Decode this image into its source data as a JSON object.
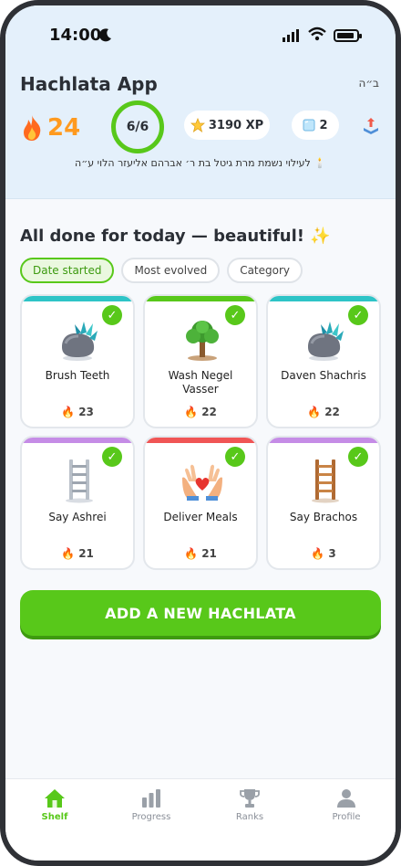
{
  "status": {
    "time": "14:00"
  },
  "header": {
    "app_title": "Hachlata App",
    "bh": "ב״ה",
    "streak": "24",
    "progress": "6/6",
    "xp": "3190 XP",
    "ice_count": "2",
    "dedication": "לעילוי נשמת מרת גיטל בת ר׳ אברהם אליעזר הלוי ע״ה"
  },
  "main": {
    "done_title": "All done for today — beautiful!",
    "chips": [
      "Date started",
      "Most evolved",
      "Category"
    ],
    "cards": [
      {
        "name": "Brush Teeth",
        "streak": "23",
        "strip": "#2ec4c7",
        "art": "rock"
      },
      {
        "name": "Wash Negel Vasser",
        "streak": "22",
        "strip": "#58c81a",
        "art": "tree"
      },
      {
        "name": "Daven Shachris",
        "streak": "22",
        "strip": "#2ec4c7",
        "art": "rock"
      },
      {
        "name": "Say Ashrei",
        "streak": "21",
        "strip": "#c58ce6",
        "art": "ladder-steel"
      },
      {
        "name": "Deliver Meals",
        "streak": "21",
        "strip": "#f05555",
        "art": "hands"
      },
      {
        "name": "Say Brachos",
        "streak": "3",
        "strip": "#c58ce6",
        "art": "ladder-wood"
      }
    ],
    "add_button": "ADD A NEW HACHLATA"
  },
  "tabs": [
    {
      "label": "Shelf",
      "icon": "home-icon",
      "active": true
    },
    {
      "label": "Progress",
      "icon": "bars-icon",
      "active": false
    },
    {
      "label": "Ranks",
      "icon": "trophy-icon",
      "active": false
    },
    {
      "label": "Profile",
      "icon": "person-icon",
      "active": false
    }
  ],
  "colors": {
    "accent": "#58c81a",
    "streak": "#ff9a1f",
    "header_bg": "#e4f0fb"
  }
}
